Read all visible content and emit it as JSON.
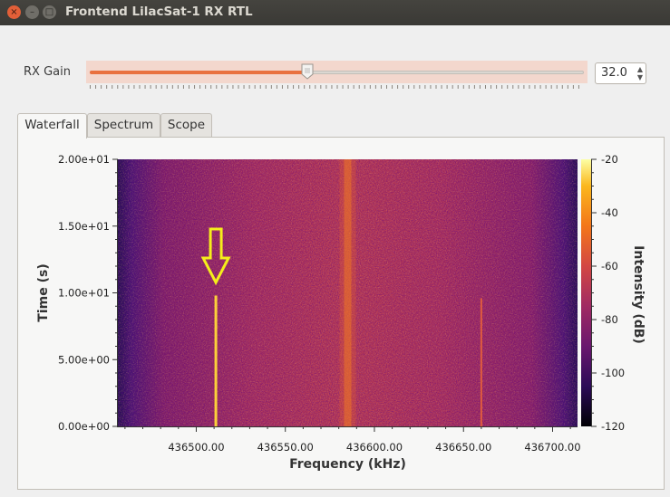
{
  "window": {
    "title": "Frontend LilacSat-1 RX RTL",
    "close_glyph": "×",
    "minimize_glyph": "–",
    "maximize_glyph": "□"
  },
  "controls": {
    "rx_gain_label": "RX Gain",
    "rx_gain_value": "32.0",
    "rx_gain_fraction": 0.44,
    "spin_up_glyph": "▲",
    "spin_down_glyph": "▼"
  },
  "tabs": [
    {
      "label": "Waterfall",
      "active": true
    },
    {
      "label": "Spectrum",
      "active": false
    },
    {
      "label": "Scope",
      "active": false
    }
  ],
  "chart_data": {
    "type": "heatmap",
    "xlabel": "Frequency (kHz)",
    "ylabel": "Time (s)",
    "colorbar_label": "Intensity (dB)",
    "xlim": [
      436456,
      436714
    ],
    "ylim": [
      0,
      20
    ],
    "x_ticks": [
      436500,
      436550,
      436600,
      436650,
      436700
    ],
    "x_tick_labels": [
      "436500.00",
      "436550.00",
      "436600.00",
      "436650.00",
      "436700.00"
    ],
    "y_ticks": [
      0,
      5,
      10,
      15,
      20
    ],
    "y_tick_labels": [
      "0.00e+00",
      "5.00e+00",
      "1.00e+01",
      "1.50e+01",
      "2.00e+01"
    ],
    "clim": [
      -120,
      -20
    ],
    "colorbar_ticks": [
      -120,
      -100,
      -80,
      -60,
      -40,
      -20
    ],
    "colorbar_tick_labels": [
      "-120",
      "-100",
      "-80",
      "-60",
      "-40",
      "-20"
    ],
    "signals": [
      {
        "frequency": 436511,
        "t_start": 0,
        "t_end": 9.8,
        "strength": "strong"
      },
      {
        "frequency": 436585,
        "t_start": 0,
        "t_end": 20,
        "strength": "band"
      },
      {
        "frequency": 436660,
        "t_start": 0,
        "t_end": 9.6,
        "strength": "weak"
      }
    ],
    "annotation": {
      "type": "arrow-down",
      "color": "#f5ef1a",
      "frequency": 436511
    }
  }
}
